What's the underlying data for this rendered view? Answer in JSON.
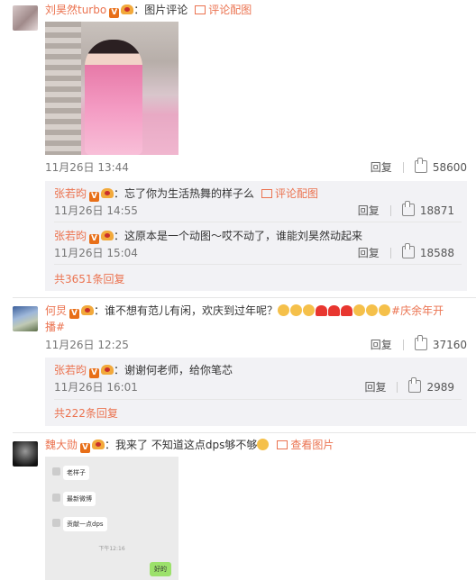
{
  "comments": [
    {
      "name": "刘昊然turbo",
      "text": "图片评论",
      "link": "评论配图",
      "time": "11月26日 13:44",
      "reply_label": "回复",
      "likes": "58600",
      "replies": [
        {
          "name": "张若昀",
          "text": "忘了你为生活热舞的样子么",
          "link": "评论配图",
          "time": "11月26日 14:55",
          "reply_label": "回复",
          "likes": "18871"
        },
        {
          "name": "张若昀",
          "text": "这原本是一个动图～哎不动了，谁能刘昊然动起来",
          "time": "11月26日 15:04",
          "reply_label": "回复",
          "likes": "18588"
        }
      ],
      "more": "共3651条回复"
    },
    {
      "name": "何炅",
      "text": "谁不想有范儿有闲，欢庆到过年呢？",
      "hashtag_end": "#庆余年开",
      "hashtag_cont": "播#",
      "time": "11月26日 12:25",
      "reply_label": "回复",
      "likes": "37160",
      "replies": [
        {
          "name": "张若昀",
          "text": "谢谢何老师，给你笔芯",
          "time": "11月26日 16:01",
          "reply_label": "回复",
          "likes": "2989"
        }
      ],
      "more": "共222条回复"
    },
    {
      "name": "魏大勋",
      "text": "我来了 不知道这点dps够不够",
      "link": "查看图片",
      "chat": {
        "bubbles": [
          "老样子",
          "最新微博",
          "贡献一点dps"
        ],
        "timestamp": "下午12:16",
        "my_bubble": "好的"
      }
    }
  ],
  "colors": {
    "accent": "#eb7350",
    "reply_bg": "#f2f2f5"
  }
}
